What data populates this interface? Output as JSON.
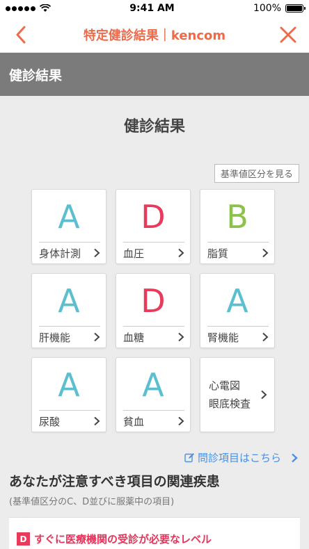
{
  "status": {
    "time": "9:41 AM",
    "battery": "100%"
  },
  "nav": {
    "title": "特定健診結果｜kencom"
  },
  "section": {
    "title": "健診結果"
  },
  "main": {
    "heading": "健診結果",
    "ref_button": "基準値区分を見る",
    "cards": [
      {
        "grade": "A",
        "label": "身体計測",
        "color": "#5bbfcf"
      },
      {
        "grade": "D",
        "label": "血圧",
        "color": "#e83a5a"
      },
      {
        "grade": "B",
        "label": "脂質",
        "color": "#8bc34a"
      },
      {
        "grade": "A",
        "label": "肝機能",
        "color": "#5bbfcf"
      },
      {
        "grade": "D",
        "label": "血糖",
        "color": "#e83a5a"
      },
      {
        "grade": "A",
        "label": "腎機能",
        "color": "#5bbfcf"
      },
      {
        "grade": "A",
        "label": "尿酸",
        "color": "#5bbfcf"
      },
      {
        "grade": "A",
        "label": "貧血",
        "color": "#5bbfcf"
      }
    ],
    "special_card": {
      "line1": "心電図",
      "line2": "眼底検査"
    },
    "questionnaire_link": "問診項目はこちら",
    "sub_heading": "あなたが注意すべき項目の関連疾患",
    "sub_note": "(基準値区分のC、D並びに服薬中の項目)",
    "alert": {
      "badge": "D",
      "text": "すぐに医療機関の受診が必要なレベル"
    }
  },
  "colors": {
    "accent": "#f06a4a",
    "link": "#4a8fe0",
    "danger": "#e83a5a"
  }
}
